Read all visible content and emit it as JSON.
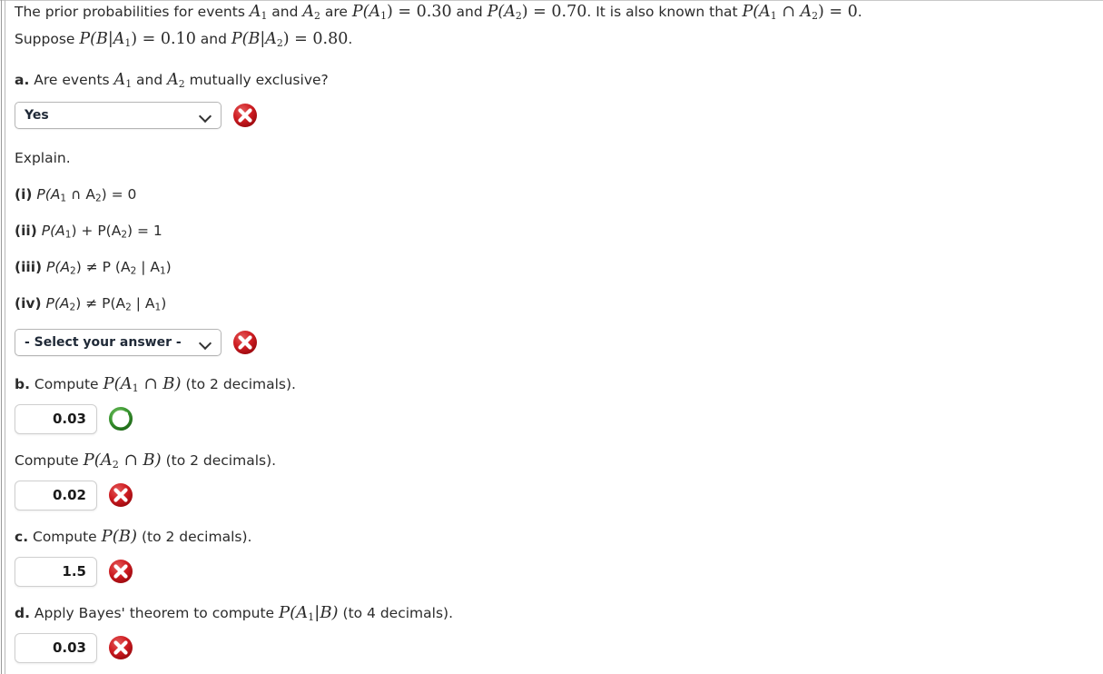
{
  "problem": {
    "line1_a": "The prior probabilities for events ",
    "line1_a1": "A",
    "line1_a1sub": "1",
    "line1_b": " and ",
    "line1_a2": "A",
    "line1_a2sub": "2",
    "line1_c": " are ",
    "line1_p1": "P(A",
    "line1_p1sub": "1",
    "line1_p1end": ") = 0.30",
    "line1_d": " and ",
    "line1_p2": "P(A",
    "line1_p2sub": "2",
    "line1_p2end": ") = 0.70",
    "line1_e": ". It is also known that ",
    "line1_p3": "P(A",
    "line1_p3sub": "1",
    "line1_p3mid": " ∩ A",
    "line1_p3sub2": "2",
    "line1_p3end": ") = 0",
    "line1_f": ".",
    "line2_a": "Suppose ",
    "line2_p1": "P(B|A",
    "line2_p1sub": "1",
    "line2_p1end": ") = 0.10",
    "line2_b": " and ",
    "line2_p2": "P(B|A",
    "line2_p2sub": "2",
    "line2_p2end": ") = 0.80",
    "line2_c": "."
  },
  "part_a": {
    "label": "a.",
    "text_before": " Are events ",
    "a1": "A",
    "a1sub": "1",
    "text_mid": " and ",
    "a2": "A",
    "a2sub": "2",
    "text_after": " mutually exclusive?",
    "select_value": "Yes",
    "marker": "incorrect-icon"
  },
  "explain": {
    "heading": "Explain.",
    "options": [
      {
        "tag": "(i)",
        "body_p": "P(A",
        "sub1": "1",
        "mid": " ∩ A",
        "sub2": "2",
        "tail": ") = 0"
      },
      {
        "tag": "(ii)",
        "body_p": "P(A",
        "sub1": "1",
        "mid": ") + P(A",
        "sub2": "2",
        "tail": ") = 1"
      },
      {
        "tag": "(iii)",
        "body_p": "P(A",
        "sub1": "2",
        "mid": ") ≠ P (A",
        "sub2": "2",
        "tail": " | A",
        "tail2sub": "1",
        "tail2": ")"
      },
      {
        "tag": "(iv)",
        "body_p": "P(A",
        "sub1": "2",
        "mid": ") ≠ P(A",
        "sub2": "2",
        "tail": " | A",
        "tail2sub": "1",
        "tail2": ")"
      }
    ],
    "select_value": "- Select your answer -",
    "marker": "incorrect-icon"
  },
  "part_b": {
    "label": "b.",
    "text_before": " Compute ",
    "math": "P(A",
    "math_sub": "1",
    "math_tail": " ∩ B)",
    "text_after": " (to 2 decimals).",
    "answer": "0.03",
    "marker": "correct-icon"
  },
  "part_b2": {
    "text_before": "Compute ",
    "math": "P(A",
    "math_sub": "2",
    "math_tail": " ∩ B)",
    "text_after": " (to 2 decimals).",
    "answer": "0.02",
    "marker": "incorrect-icon"
  },
  "part_c": {
    "label": "c.",
    "text_before": " Compute ",
    "math": "P(B)",
    "text_after": " (to 2 decimals).",
    "answer": "1.5",
    "marker": "incorrect-icon"
  },
  "part_d": {
    "label": "d.",
    "text_before": " Apply Bayes' theorem to compute ",
    "math": "P(A",
    "math_sub": "1",
    "math_tail": "|B)",
    "text_after": " (to 4 decimals).",
    "answer": "0.03",
    "marker": "incorrect-icon"
  },
  "colors": {
    "incorrect_red": "#c2121a",
    "correct_green": "#3f9c35",
    "text": "#2b2b2b",
    "border": "#b5b5b5",
    "background": "#ffffff"
  }
}
